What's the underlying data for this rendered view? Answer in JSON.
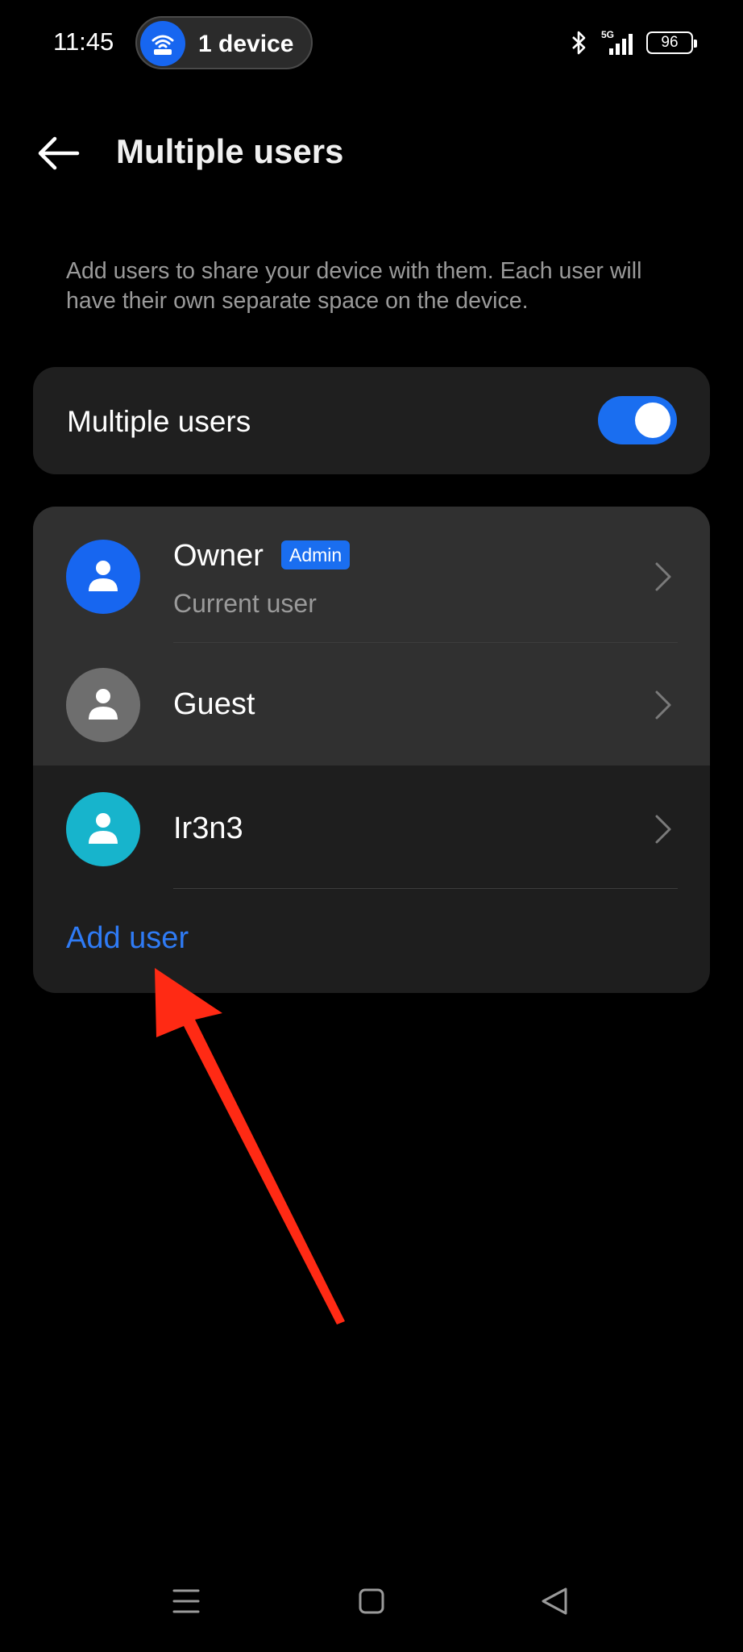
{
  "status_bar": {
    "time": "11:45",
    "hotspot_label": "1 device",
    "network": "5G",
    "battery": "96"
  },
  "header": {
    "title": "Multiple users"
  },
  "description": "Add users to share your device with them. Each user will have their own separate space on the device.",
  "toggle": {
    "label": "Multiple users",
    "on": true
  },
  "users": [
    {
      "name": "Owner",
      "badge": "Admin",
      "subtitle": "Current user",
      "avatar_color": "#1766f0"
    },
    {
      "name": "Guest",
      "avatar_color": "#6e6e6e"
    },
    {
      "name": "Ir3n3",
      "avatar_color": "#17b4cc"
    }
  ],
  "add_user_label": "Add user",
  "colors": {
    "accent": "#1a6ef0",
    "link": "#2f7bf5",
    "annotation_arrow": "#ff2a14"
  }
}
